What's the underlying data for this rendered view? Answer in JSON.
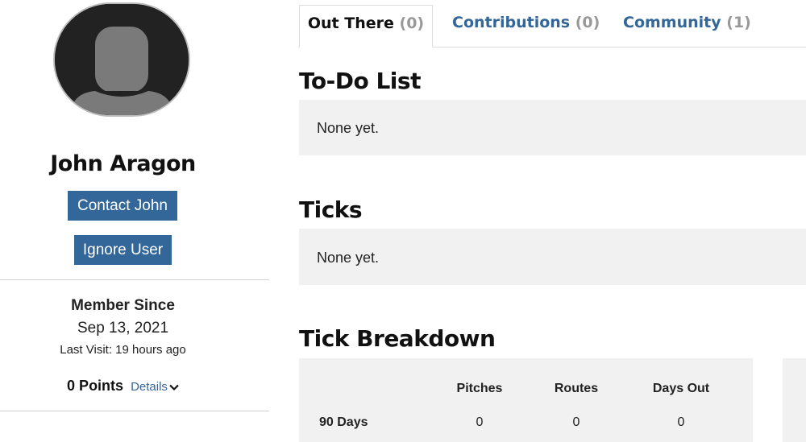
{
  "profile": {
    "name": "John Aragon",
    "contact_label": "Contact John",
    "ignore_label": "Ignore User",
    "member_since_label": "Member Since",
    "member_since_date": "Sep 13, 2021",
    "last_visit": "Last Visit: 19 hours ago",
    "points": "0 Points",
    "details_label": "Details"
  },
  "tabs": [
    {
      "label": "Out There",
      "count": "(0)",
      "active": true
    },
    {
      "label": "Contributions",
      "count": "(0)",
      "active": false
    },
    {
      "label": "Community",
      "count": "(1)",
      "active": false
    }
  ],
  "sections": {
    "todo": {
      "title": "To-Do List",
      "empty_text": "None yet."
    },
    "ticks": {
      "title": "Ticks",
      "empty_text": "None yet."
    },
    "breakdown": {
      "title": "Tick Breakdown",
      "columns": [
        "Pitches",
        "Routes",
        "Days Out"
      ],
      "rows": [
        {
          "label": "90 Days",
          "values": [
            "0",
            "0",
            "0"
          ]
        }
      ]
    }
  },
  "colors": {
    "accent": "#336699",
    "panel_bg": "#f1f1f1",
    "muted_count": "#999999"
  },
  "icons": {
    "avatar": "default-user-silhouette",
    "details": "chevron-down-icon"
  }
}
